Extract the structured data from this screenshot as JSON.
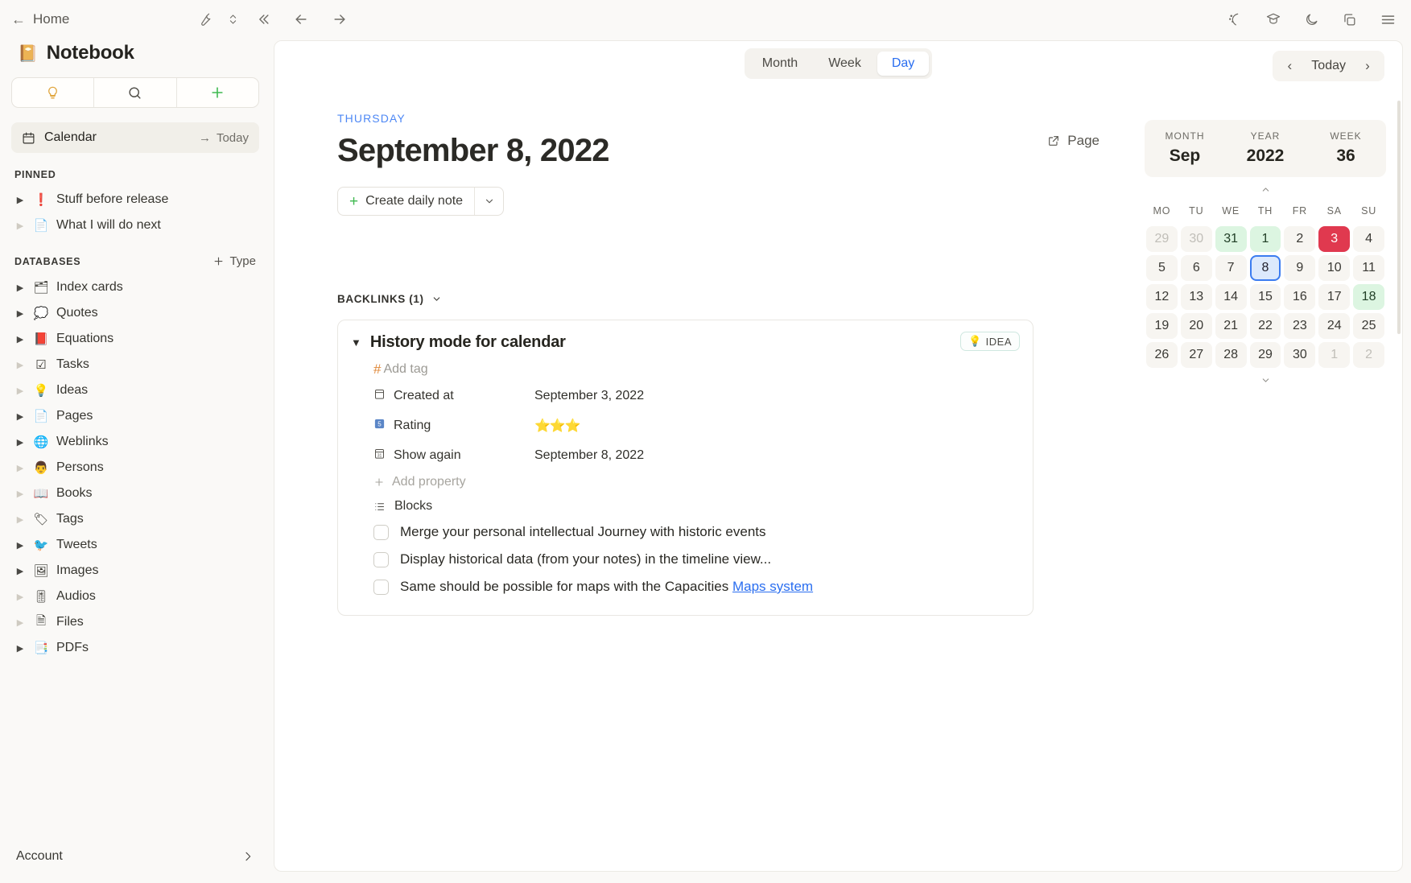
{
  "topbar": {
    "home_label": "Home",
    "back_arrow": "←",
    "icons": {
      "wrench": "wrench-icon",
      "updown": "updown-icon",
      "collapse": "«",
      "back": "←",
      "forward": "→",
      "magic": "magic-icon",
      "graduation": "graduation-cap-icon",
      "moon": "moon-icon",
      "windows": "copy-windows-icon",
      "menu": "hamburger-menu-icon"
    }
  },
  "sidebar": {
    "notebook_emoji": "📔",
    "notebook_title": "Notebook",
    "segmented": [
      {
        "name": "idea-button",
        "icon": "lightbulb-icon"
      },
      {
        "name": "search-button",
        "icon": "search-icon"
      },
      {
        "name": "add-button",
        "icon": "plus-icon"
      }
    ],
    "calendar_label": "Calendar",
    "today_label": "Today",
    "today_arrow": "→",
    "pinned_header": "PINNED",
    "pinned": [
      {
        "label": "Stuff before release",
        "emoji": "❗",
        "expandable": true
      },
      {
        "label": "What I will do next",
        "emoji": "📄",
        "expandable": false
      }
    ],
    "databases_header": "DATABASES",
    "add_type_label": "Type",
    "databases": [
      {
        "label": "Index cards",
        "emoji": "🗂",
        "expandable": true
      },
      {
        "label": "Quotes",
        "emoji": "💭",
        "expandable": true
      },
      {
        "label": "Equations",
        "emoji": "📕",
        "expandable": true
      },
      {
        "label": "Tasks",
        "emoji": "☑",
        "expandable": false
      },
      {
        "label": "Ideas",
        "emoji": "💡",
        "expandable": false
      },
      {
        "label": "Pages",
        "emoji": "📄",
        "expandable": true
      },
      {
        "label": "Weblinks",
        "emoji": "🌐",
        "expandable": true
      },
      {
        "label": "Persons",
        "emoji": "👨",
        "expandable": false
      },
      {
        "label": "Books",
        "emoji": "📖",
        "expandable": false
      },
      {
        "label": "Tags",
        "emoji": "🏷",
        "expandable": false
      },
      {
        "label": "Tweets",
        "emoji": "🐦",
        "expandable": true
      },
      {
        "label": "Images",
        "emoji": "🖼",
        "expandable": true
      },
      {
        "label": "Audios",
        "emoji": "🎚",
        "expandable": false
      },
      {
        "label": "Files",
        "emoji": "🗎",
        "expandable": false
      },
      {
        "label": "PDFs",
        "emoji": "📑",
        "expandable": true
      }
    ],
    "account_label": "Account",
    "account_chevron": "›"
  },
  "main": {
    "views": [
      {
        "label": "Month",
        "active": false
      },
      {
        "label": "Week",
        "active": false
      },
      {
        "label": "Day",
        "active": true
      }
    ],
    "today_nav": {
      "prev": "‹",
      "label": "Today",
      "next": "›"
    },
    "weekday": "THURSDAY",
    "date_title": "September 8, 2022",
    "page_button": "Page",
    "create_note_label": "Create daily note",
    "create_note_plus": "+",
    "create_note_caret": "⌵",
    "backlinks_label": "BACKLINKS (1)",
    "backlinks_caret": "⌵"
  },
  "card": {
    "caret": "▼",
    "title": "History mode for calendar",
    "badge_label": "IDEA",
    "badge_emoji": "💡",
    "add_tag": "Add tag",
    "add_tag_hash": "#",
    "properties": [
      {
        "icon": "calendar-icon",
        "key": "Created at",
        "value": "September 3, 2022",
        "type": "date"
      },
      {
        "icon": "number-5-icon",
        "key": "Rating",
        "value": "⭐⭐⭐",
        "type": "stars"
      },
      {
        "icon": "calendar-day-icon",
        "key": "Show again",
        "value": "September 8, 2022",
        "type": "date"
      }
    ],
    "add_property": "Add property",
    "blocks_label": "Blocks",
    "todos": [
      {
        "text": "Merge your personal intellectual Journey with historic events",
        "checked": false,
        "link": null
      },
      {
        "text": "Display historical data (from your notes) in the timeline view...",
        "checked": false,
        "link": null
      },
      {
        "text": "Same should be possible for maps with the Capacities ",
        "checked": false,
        "link": "Maps system"
      }
    ]
  },
  "mini_calendar": {
    "month_key": "MONTH",
    "month_value": "Sep",
    "year_key": "YEAR",
    "year_value": "2022",
    "week_key": "WEEK",
    "week_value": "36",
    "up_chevron": "⌃",
    "down_chevron": "⌄",
    "dow": [
      "MO",
      "TU",
      "WE",
      "TH",
      "FR",
      "SA",
      "SU"
    ],
    "days": [
      {
        "d": "29",
        "s": "out"
      },
      {
        "d": "30",
        "s": "out"
      },
      {
        "d": "31",
        "s": "green"
      },
      {
        "d": "1",
        "s": "green"
      },
      {
        "d": "2",
        "s": "plain"
      },
      {
        "d": "3",
        "s": "red"
      },
      {
        "d": "4",
        "s": "plain"
      },
      {
        "d": "5",
        "s": "plain"
      },
      {
        "d": "6",
        "s": "plain"
      },
      {
        "d": "7",
        "s": "plain"
      },
      {
        "d": "8",
        "s": "sel"
      },
      {
        "d": "9",
        "s": "plain"
      },
      {
        "d": "10",
        "s": "plain"
      },
      {
        "d": "11",
        "s": "plain"
      },
      {
        "d": "12",
        "s": "plain"
      },
      {
        "d": "13",
        "s": "plain"
      },
      {
        "d": "14",
        "s": "plain"
      },
      {
        "d": "15",
        "s": "plain"
      },
      {
        "d": "16",
        "s": "plain"
      },
      {
        "d": "17",
        "s": "plain"
      },
      {
        "d": "18",
        "s": "green"
      },
      {
        "d": "19",
        "s": "plain"
      },
      {
        "d": "20",
        "s": "plain"
      },
      {
        "d": "21",
        "s": "plain"
      },
      {
        "d": "22",
        "s": "plain"
      },
      {
        "d": "23",
        "s": "plain"
      },
      {
        "d": "24",
        "s": "plain"
      },
      {
        "d": "25",
        "s": "plain"
      },
      {
        "d": "26",
        "s": "plain"
      },
      {
        "d": "27",
        "s": "plain"
      },
      {
        "d": "28",
        "s": "plain"
      },
      {
        "d": "29",
        "s": "plain"
      },
      {
        "d": "30",
        "s": "plain"
      },
      {
        "d": "1",
        "s": "out"
      },
      {
        "d": "2",
        "s": "out"
      }
    ]
  },
  "colors": {
    "accent_blue": "#2a6ef0",
    "green_day": "#dcf5e1",
    "red_day": "#e0394f",
    "selected_day": "#dce9fc",
    "app_bg": "#faf9f7"
  }
}
